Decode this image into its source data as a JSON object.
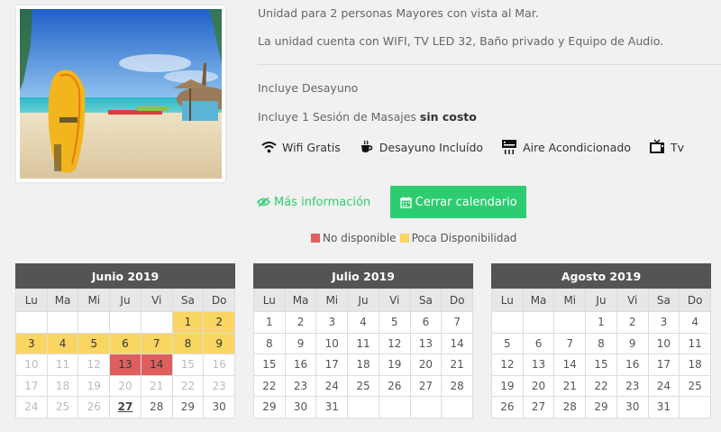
{
  "description": {
    "line1": "Unidad para 2 personas Mayores con vista al Mar.",
    "line2": "La unidad cuenta con WIFI, TV LED 32, Baño privado y Equipo de Audio.",
    "breakfast": "Incluye Desayuno",
    "massage_prefix": "Incluye 1 Sesión de Masajes ",
    "massage_bold": "sin costo"
  },
  "amenities": [
    {
      "label": "Wifi Gratis",
      "icon": "wifi-icon"
    },
    {
      "label": "Desayuno Incluído",
      "icon": "coffee-cup-icon"
    },
    {
      "label": "Aire Acondicionado",
      "icon": "air-conditioner-icon"
    },
    {
      "label": "Tv",
      "icon": "tv-icon"
    }
  ],
  "actions": {
    "more_info": "Más información",
    "close_calendar": "Cerrar calendario"
  },
  "legend": {
    "unavailable": "No disponible",
    "low": "Poca Disponibilidad"
  },
  "colors": {
    "accent": "#2ecc71",
    "unavailable": "#df5f5f",
    "low": "#f9d562",
    "header": "#545454"
  },
  "weekdays": [
    "Lu",
    "Ma",
    "Mi",
    "Ju",
    "Vi",
    "Sa",
    "Do"
  ],
  "calendars": [
    {
      "title": "Junio 2019",
      "offset": 5,
      "days": 30,
      "poca": [
        1,
        2,
        3,
        4,
        5,
        6,
        7,
        8,
        9
      ],
      "unavailable": [
        13,
        14
      ],
      "past_before": 27,
      "today": 27
    },
    {
      "title": "Julio 2019",
      "offset": 0,
      "days": 31,
      "poca": [],
      "unavailable": [],
      "past_before": 0,
      "today": 0
    },
    {
      "title": "Agosto 2019",
      "offset": 3,
      "days": 31,
      "poca": [],
      "unavailable": [],
      "past_before": 0,
      "today": 0
    }
  ]
}
